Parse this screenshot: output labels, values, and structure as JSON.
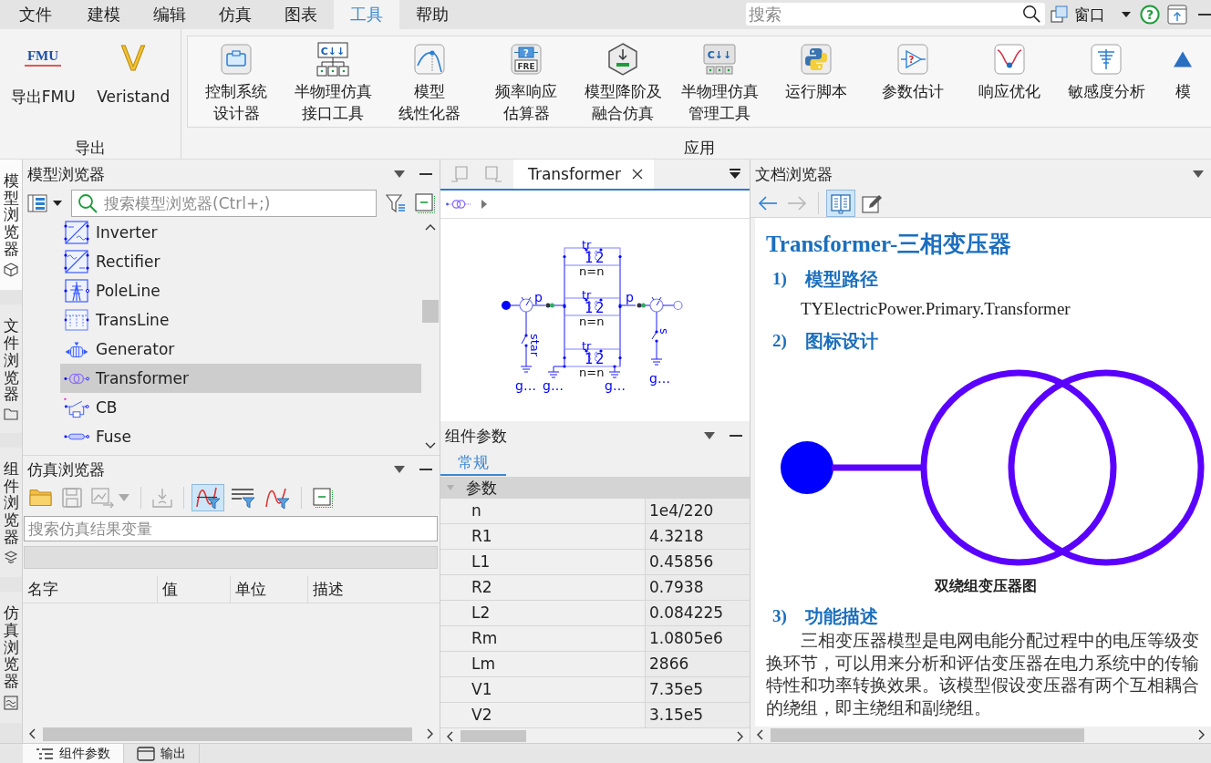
{
  "menu_bar": {
    "tabs": [
      {
        "label": "文件",
        "selected": false
      },
      {
        "label": "建模",
        "selected": false
      },
      {
        "label": "编辑",
        "selected": false
      },
      {
        "label": "仿真",
        "selected": false
      },
      {
        "label": "图表",
        "selected": false
      },
      {
        "label": "工具",
        "selected": true
      },
      {
        "label": "帮助",
        "selected": false
      }
    ],
    "search": {
      "placeholder": "搜索"
    },
    "window_menu": {
      "label": "窗口"
    },
    "help_button": {
      "icon_text": "?"
    }
  },
  "ribbon": {
    "groups": [
      {
        "label": "导出",
        "kind": "plain",
        "buttons": [
          {
            "lines": [
              "导出FMU"
            ],
            "icon_text": [
              "FMU"
            ]
          },
          {
            "lines": [
              "Veristand"
            ],
            "icon_text": [
              "V"
            ]
          }
        ]
      },
      {
        "label": "应用",
        "kind": "panel",
        "buttons": [
          {
            "lines": [
              "控制系统",
              "设计器"
            ]
          },
          {
            "lines": [
              "半物理仿真",
              "接口工具"
            ],
            "icon_text": [
              "C↓↓"
            ]
          },
          {
            "lines": [
              "模型",
              "线性化器"
            ]
          },
          {
            "lines": [
              "频率响应",
              "估算器"
            ],
            "icon_text": [
              "?",
              "FRE"
            ]
          },
          {
            "lines": [
              "模型降阶及",
              "融合仿真"
            ]
          },
          {
            "lines": [
              "半物理仿真",
              "管理工具"
            ],
            "icon_text": [
              "C↓↓"
            ]
          },
          {
            "lines": [
              "运行脚本"
            ]
          },
          {
            "lines": [
              "参数估计"
            ],
            "icon_text": [
              "?"
            ]
          },
          {
            "lines": [
              "响应优化"
            ]
          },
          {
            "lines": [
              "敏感度分析"
            ]
          },
          {
            "lines": [
              "模"
            ]
          }
        ]
      }
    ]
  },
  "side_tabs": [
    {
      "label": "模型浏览器",
      "selected": true
    },
    {
      "label": "文件浏览器",
      "selected": false
    },
    {
      "label": "组件浏览器",
      "selected": false
    },
    {
      "label": "仿真浏览器",
      "selected": false
    }
  ],
  "model_browser": {
    "title": "模型浏览器",
    "search": {
      "placeholder": "搜索模型浏览器(Ctrl+;)"
    },
    "items": [
      {
        "label": "Inverter",
        "selected": false
      },
      {
        "label": "Rectifier",
        "selected": false
      },
      {
        "label": "PoleLine",
        "selected": false
      },
      {
        "label": "TransLine",
        "selected": false
      },
      {
        "label": "Generator",
        "selected": false
      },
      {
        "label": "Transformer",
        "selected": true
      },
      {
        "label": "CB",
        "selected": false
      },
      {
        "label": "Fuse",
        "selected": false
      }
    ]
  },
  "simulation_browser": {
    "title": "仿真浏览器",
    "toolbar": [
      {
        "disabled": false,
        "selected": false
      },
      {
        "disabled": true,
        "selected": false
      },
      {
        "disabled": true,
        "selected": false
      },
      {
        "disabled": true,
        "selected": false
      },
      {
        "disabled": false,
        "selected": true
      },
      {
        "disabled": false,
        "selected": false
      },
      {
        "disabled": false,
        "selected": false
      },
      {
        "disabled": false,
        "selected": false
      }
    ],
    "search": {
      "placeholder": "搜索仿真结果变量"
    },
    "columns": [
      "名字",
      "值",
      "单位",
      "描述"
    ]
  },
  "editor": {
    "navigation": [
      {
        "disabled": true
      },
      {
        "disabled": true
      }
    ],
    "tabs": [
      {
        "label": "Transformer",
        "selected": true
      }
    ],
    "diagram": {
      "ports": [
        "p",
        "p"
      ],
      "transformers": [
        {
          "label": "tr",
          "primary": "1",
          "secondary": "2",
          "parameter": "n=n"
        },
        {
          "label": "tr",
          "primary": "1",
          "secondary": "2",
          "parameter": "n=n"
        },
        {
          "label": "tr",
          "primary": "1",
          "secondary": "2",
          "parameter": "n=n"
        }
      ],
      "switches": [
        "star",
        "s"
      ],
      "grounds": [
        "g…",
        "g…",
        "g…",
        "g…"
      ]
    }
  },
  "component_parameters": {
    "title": "组件参数",
    "tabs": [
      {
        "label": "常规",
        "selected": true
      }
    ],
    "group": {
      "label": "参数",
      "expanded": true
    },
    "rows": [
      {
        "name": "n",
        "value": "1e4/220"
      },
      {
        "name": "R1",
        "value": "4.3218"
      },
      {
        "name": "L1",
        "value": "0.45856"
      },
      {
        "name": "R2",
        "value": "0.7938"
      },
      {
        "name": "L2",
        "value": "0.084225"
      },
      {
        "name": "Rm",
        "value": "1.0805e6"
      },
      {
        "name": "Lm",
        "value": "2866"
      },
      {
        "name": "V1",
        "value": "7.35e5"
      },
      {
        "name": "V2",
        "value": "3.15e5"
      }
    ]
  },
  "document_browser": {
    "title": "文档浏览器",
    "toolbar": [
      {
        "disabled": false,
        "selected": false
      },
      {
        "disabled": true,
        "selected": false
      },
      {
        "disabled": false,
        "selected": true
      },
      {
        "disabled": false,
        "selected": false
      }
    ],
    "heading": "Transformer-三相变压器",
    "sections": [
      {
        "number": "1)",
        "title": "模型路径",
        "kind": "text",
        "text": "TYElectricPower.Primary.Transformer"
      },
      {
        "number": "2)",
        "title": "图标设计",
        "kind": "figure",
        "caption": "双绕组变压器图"
      },
      {
        "number": "3)",
        "title": "功能描述",
        "kind": "paragraph",
        "text": "三相变压器模型是电网电能分配过程中的电压等级变换环节，可以用来分析和评估变压器在电力系统中的传输特性和功率转换效果。该模型假设变压器有两个互相耦合的绕组，即主绕组和副绕组。"
      }
    ]
  },
  "bottom_tabs": [
    {
      "label": "组件参数",
      "selected": true
    },
    {
      "label": "输出",
      "selected": false
    }
  ]
}
